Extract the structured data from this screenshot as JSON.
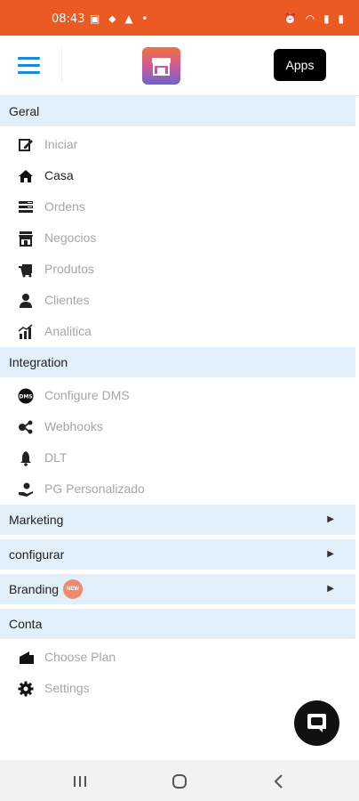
{
  "status_bar": {
    "time": "08:43",
    "left_icons": "▣ ⬥ ▲ •",
    "right_icons": "⏰ ◠ ▮ ▮"
  },
  "header": {
    "logo": "store-icon",
    "apps_label": "Apps",
    "accent": "#1a8ad6"
  },
  "menu": {
    "geral": {
      "title": "Geral",
      "items": [
        {
          "label": "Iniciar",
          "icon": "edit-icon"
        },
        {
          "label": "Casa",
          "icon": "home-icon"
        },
        {
          "label": "Ordens",
          "icon": "list-icon"
        },
        {
          "label": "Negocios",
          "icon": "store-icon"
        },
        {
          "label": "Produtos",
          "icon": "products-icon"
        },
        {
          "label": "Clientes",
          "icon": "person-icon"
        },
        {
          "label": "Analitica",
          "icon": "chart-icon"
        }
      ]
    },
    "integration": {
      "title": "Integration",
      "items": [
        {
          "label": "Configure DMS",
          "icon": "dms-icon"
        },
        {
          "label": "Webhooks",
          "icon": "webhooks-icon"
        },
        {
          "label": "DLT",
          "icon": "bell-icon"
        },
        {
          "label": "PG Personalizado",
          "icon": "payment-icon"
        }
      ]
    },
    "marketing": {
      "title": "Marketing"
    },
    "configurar": {
      "title": "configurar"
    },
    "branding": {
      "title": "Branding",
      "badge": "NEW"
    },
    "conta": {
      "title": "Conta",
      "items": [
        {
          "label": "Choose Plan",
          "icon": "plan-icon"
        },
        {
          "label": "Settings",
          "icon": "gear-icon"
        }
      ]
    }
  },
  "colors": {
    "status_bar": "#ec5a24",
    "section_bg": "#e2f0fb",
    "inactive_text": "#a6a6a6",
    "active_text": "#222222"
  }
}
